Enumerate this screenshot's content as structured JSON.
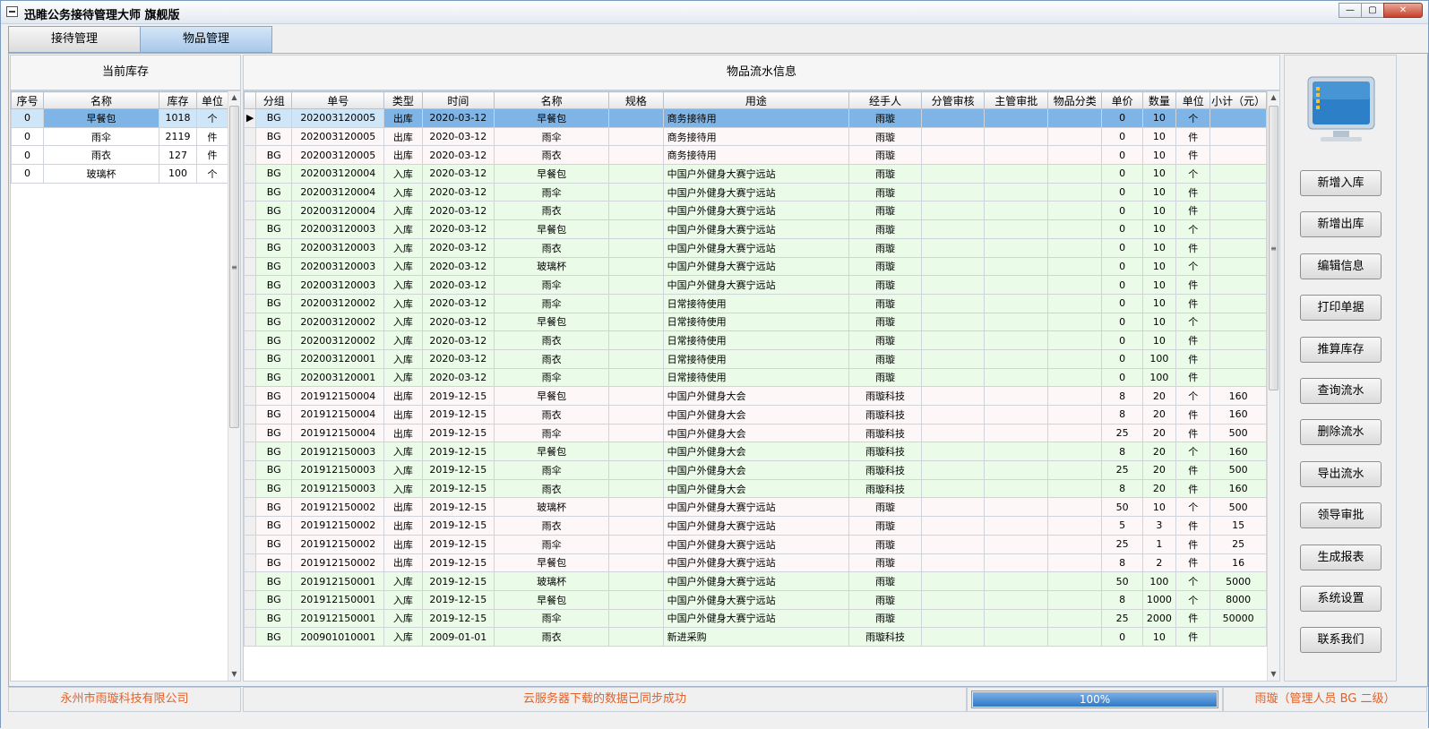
{
  "window": {
    "title": "迅睢公务接待管理大师   旗舰版"
  },
  "tabs": [
    {
      "label": "接待管理"
    },
    {
      "label": "物品管理"
    }
  ],
  "inventory": {
    "header": "当前库存",
    "columns": [
      "序号",
      "名称",
      "库存",
      "单位"
    ],
    "rows": [
      {
        "seq": "0",
        "name": "早餐包",
        "stock": "1018",
        "unit": "个"
      },
      {
        "seq": "0",
        "name": "雨伞",
        "stock": "2119",
        "unit": "件"
      },
      {
        "seq": "0",
        "name": "雨衣",
        "stock": "127",
        "unit": "件"
      },
      {
        "seq": "0",
        "name": "玻璃杯",
        "stock": "100",
        "unit": "个"
      }
    ]
  },
  "flow": {
    "header": "物品流水信息",
    "columns": [
      "分组",
      "单号",
      "类型",
      "时间",
      "名称",
      "规格",
      "用途",
      "经手人",
      "分管审核",
      "主管审批",
      "物品分类",
      "单价",
      "数量",
      "单位",
      "小计（元）"
    ],
    "rows": [
      {
        "group": "BG",
        "no": "202003120005",
        "type": "出库",
        "time": "2020-03-12",
        "name": "早餐包",
        "spec": "",
        "purpose": "商务接待用",
        "handler": "雨璇",
        "r1": "",
        "r2": "",
        "cat": "",
        "price": "0",
        "qty": "10",
        "unit": "个",
        "subtotal": ""
      },
      {
        "group": "BG",
        "no": "202003120005",
        "type": "出库",
        "time": "2020-03-12",
        "name": "雨伞",
        "spec": "",
        "purpose": "商务接待用",
        "handler": "雨璇",
        "r1": "",
        "r2": "",
        "cat": "",
        "price": "0",
        "qty": "10",
        "unit": "件",
        "subtotal": ""
      },
      {
        "group": "BG",
        "no": "202003120005",
        "type": "出库",
        "time": "2020-03-12",
        "name": "雨衣",
        "spec": "",
        "purpose": "商务接待用",
        "handler": "雨璇",
        "r1": "",
        "r2": "",
        "cat": "",
        "price": "0",
        "qty": "10",
        "unit": "件",
        "subtotal": ""
      },
      {
        "group": "BG",
        "no": "202003120004",
        "type": "入库",
        "time": "2020-03-12",
        "name": "早餐包",
        "spec": "",
        "purpose": "中国户外健身大赛宁远站",
        "handler": "雨璇",
        "r1": "",
        "r2": "",
        "cat": "",
        "price": "0",
        "qty": "10",
        "unit": "个",
        "subtotal": ""
      },
      {
        "group": "BG",
        "no": "202003120004",
        "type": "入库",
        "time": "2020-03-12",
        "name": "雨伞",
        "spec": "",
        "purpose": "中国户外健身大赛宁远站",
        "handler": "雨璇",
        "r1": "",
        "r2": "",
        "cat": "",
        "price": "0",
        "qty": "10",
        "unit": "件",
        "subtotal": ""
      },
      {
        "group": "BG",
        "no": "202003120004",
        "type": "入库",
        "time": "2020-03-12",
        "name": "雨衣",
        "spec": "",
        "purpose": "中国户外健身大赛宁远站",
        "handler": "雨璇",
        "r1": "",
        "r2": "",
        "cat": "",
        "price": "0",
        "qty": "10",
        "unit": "件",
        "subtotal": ""
      },
      {
        "group": "BG",
        "no": "202003120003",
        "type": "入库",
        "time": "2020-03-12",
        "name": "早餐包",
        "spec": "",
        "purpose": "中国户外健身大赛宁远站",
        "handler": "雨璇",
        "r1": "",
        "r2": "",
        "cat": "",
        "price": "0",
        "qty": "10",
        "unit": "个",
        "subtotal": ""
      },
      {
        "group": "BG",
        "no": "202003120003",
        "type": "入库",
        "time": "2020-03-12",
        "name": "雨衣",
        "spec": "",
        "purpose": "中国户外健身大赛宁远站",
        "handler": "雨璇",
        "r1": "",
        "r2": "",
        "cat": "",
        "price": "0",
        "qty": "10",
        "unit": "件",
        "subtotal": ""
      },
      {
        "group": "BG",
        "no": "202003120003",
        "type": "入库",
        "time": "2020-03-12",
        "name": "玻璃杯",
        "spec": "",
        "purpose": "中国户外健身大赛宁远站",
        "handler": "雨璇",
        "r1": "",
        "r2": "",
        "cat": "",
        "price": "0",
        "qty": "10",
        "unit": "个",
        "subtotal": ""
      },
      {
        "group": "BG",
        "no": "202003120003",
        "type": "入库",
        "time": "2020-03-12",
        "name": "雨伞",
        "spec": "",
        "purpose": "中国户外健身大赛宁远站",
        "handler": "雨璇",
        "r1": "",
        "r2": "",
        "cat": "",
        "price": "0",
        "qty": "10",
        "unit": "件",
        "subtotal": ""
      },
      {
        "group": "BG",
        "no": "202003120002",
        "type": "入库",
        "time": "2020-03-12",
        "name": "雨伞",
        "spec": "",
        "purpose": "日常接待使用",
        "handler": "雨璇",
        "r1": "",
        "r2": "",
        "cat": "",
        "price": "0",
        "qty": "10",
        "unit": "件",
        "subtotal": ""
      },
      {
        "group": "BG",
        "no": "202003120002",
        "type": "入库",
        "time": "2020-03-12",
        "name": "早餐包",
        "spec": "",
        "purpose": "日常接待使用",
        "handler": "雨璇",
        "r1": "",
        "r2": "",
        "cat": "",
        "price": "0",
        "qty": "10",
        "unit": "个",
        "subtotal": ""
      },
      {
        "group": "BG",
        "no": "202003120002",
        "type": "入库",
        "time": "2020-03-12",
        "name": "雨衣",
        "spec": "",
        "purpose": "日常接待使用",
        "handler": "雨璇",
        "r1": "",
        "r2": "",
        "cat": "",
        "price": "0",
        "qty": "10",
        "unit": "件",
        "subtotal": ""
      },
      {
        "group": "BG",
        "no": "202003120001",
        "type": "入库",
        "time": "2020-03-12",
        "name": "雨衣",
        "spec": "",
        "purpose": "日常接待使用",
        "handler": "雨璇",
        "r1": "",
        "r2": "",
        "cat": "",
        "price": "0",
        "qty": "100",
        "unit": "件",
        "subtotal": ""
      },
      {
        "group": "BG",
        "no": "202003120001",
        "type": "入库",
        "time": "2020-03-12",
        "name": "雨伞",
        "spec": "",
        "purpose": "日常接待使用",
        "handler": "雨璇",
        "r1": "",
        "r2": "",
        "cat": "",
        "price": "0",
        "qty": "100",
        "unit": "件",
        "subtotal": ""
      },
      {
        "group": "BG",
        "no": "201912150004",
        "type": "出库",
        "time": "2019-12-15",
        "name": "早餐包",
        "spec": "",
        "purpose": "中国户外健身大会",
        "handler": "雨璇科技",
        "r1": "",
        "r2": "",
        "cat": "",
        "price": "8",
        "qty": "20",
        "unit": "个",
        "subtotal": "160"
      },
      {
        "group": "BG",
        "no": "201912150004",
        "type": "出库",
        "time": "2019-12-15",
        "name": "雨衣",
        "spec": "",
        "purpose": "中国户外健身大会",
        "handler": "雨璇科技",
        "r1": "",
        "r2": "",
        "cat": "",
        "price": "8",
        "qty": "20",
        "unit": "件",
        "subtotal": "160"
      },
      {
        "group": "BG",
        "no": "201912150004",
        "type": "出库",
        "time": "2019-12-15",
        "name": "雨伞",
        "spec": "",
        "purpose": "中国户外健身大会",
        "handler": "雨璇科技",
        "r1": "",
        "r2": "",
        "cat": "",
        "price": "25",
        "qty": "20",
        "unit": "件",
        "subtotal": "500"
      },
      {
        "group": "BG",
        "no": "201912150003",
        "type": "入库",
        "time": "2019-12-15",
        "name": "早餐包",
        "spec": "",
        "purpose": "中国户外健身大会",
        "handler": "雨璇科技",
        "r1": "",
        "r2": "",
        "cat": "",
        "price": "8",
        "qty": "20",
        "unit": "个",
        "subtotal": "160"
      },
      {
        "group": "BG",
        "no": "201912150003",
        "type": "入库",
        "time": "2019-12-15",
        "name": "雨伞",
        "spec": "",
        "purpose": "中国户外健身大会",
        "handler": "雨璇科技",
        "r1": "",
        "r2": "",
        "cat": "",
        "price": "25",
        "qty": "20",
        "unit": "件",
        "subtotal": "500"
      },
      {
        "group": "BG",
        "no": "201912150003",
        "type": "入库",
        "time": "2019-12-15",
        "name": "雨衣",
        "spec": "",
        "purpose": "中国户外健身大会",
        "handler": "雨璇科技",
        "r1": "",
        "r2": "",
        "cat": "",
        "price": "8",
        "qty": "20",
        "unit": "件",
        "subtotal": "160"
      },
      {
        "group": "BG",
        "no": "201912150002",
        "type": "出库",
        "time": "2019-12-15",
        "name": "玻璃杯",
        "spec": "",
        "purpose": "中国户外健身大赛宁远站",
        "handler": "雨璇",
        "r1": "",
        "r2": "",
        "cat": "",
        "price": "50",
        "qty": "10",
        "unit": "个",
        "subtotal": "500"
      },
      {
        "group": "BG",
        "no": "201912150002",
        "type": "出库",
        "time": "2019-12-15",
        "name": "雨衣",
        "spec": "",
        "purpose": "中国户外健身大赛宁远站",
        "handler": "雨璇",
        "r1": "",
        "r2": "",
        "cat": "",
        "price": "5",
        "qty": "3",
        "unit": "件",
        "subtotal": "15"
      },
      {
        "group": "BG",
        "no": "201912150002",
        "type": "出库",
        "time": "2019-12-15",
        "name": "雨伞",
        "spec": "",
        "purpose": "中国户外健身大赛宁远站",
        "handler": "雨璇",
        "r1": "",
        "r2": "",
        "cat": "",
        "price": "25",
        "qty": "1",
        "unit": "件",
        "subtotal": "25"
      },
      {
        "group": "BG",
        "no": "201912150002",
        "type": "出库",
        "time": "2019-12-15",
        "name": "早餐包",
        "spec": "",
        "purpose": "中国户外健身大赛宁远站",
        "handler": "雨璇",
        "r1": "",
        "r2": "",
        "cat": "",
        "price": "8",
        "qty": "2",
        "unit": "件",
        "subtotal": "16"
      },
      {
        "group": "BG",
        "no": "201912150001",
        "type": "入库",
        "time": "2019-12-15",
        "name": "玻璃杯",
        "spec": "",
        "purpose": "中国户外健身大赛宁远站",
        "handler": "雨璇",
        "r1": "",
        "r2": "",
        "cat": "",
        "price": "50",
        "qty": "100",
        "unit": "个",
        "subtotal": "5000"
      },
      {
        "group": "BG",
        "no": "201912150001",
        "type": "入库",
        "time": "2019-12-15",
        "name": "早餐包",
        "spec": "",
        "purpose": "中国户外健身大赛宁远站",
        "handler": "雨璇",
        "r1": "",
        "r2": "",
        "cat": "",
        "price": "8",
        "qty": "1000",
        "unit": "个",
        "subtotal": "8000"
      },
      {
        "group": "BG",
        "no": "201912150001",
        "type": "入库",
        "time": "2019-12-15",
        "name": "雨伞",
        "spec": "",
        "purpose": "中国户外健身大赛宁远站",
        "handler": "雨璇",
        "r1": "",
        "r2": "",
        "cat": "",
        "price": "25",
        "qty": "2000",
        "unit": "件",
        "subtotal": "50000"
      },
      {
        "group": "BG",
        "no": "200901010001",
        "type": "入库",
        "time": "2009-01-01",
        "name": "雨衣",
        "spec": "",
        "purpose": "新进采购",
        "handler": "雨璇科技",
        "r1": "",
        "r2": "",
        "cat": "",
        "price": "0",
        "qty": "10",
        "unit": "件",
        "subtotal": ""
      }
    ]
  },
  "actions": [
    "新增入库",
    "新增出库",
    "编辑信息",
    "打印单据",
    "推算库存",
    "查询流水",
    "删除流水",
    "导出流水",
    "领导审批",
    "生成报表",
    "系统设置",
    "联系我们"
  ],
  "status": {
    "company": "永州市雨璇科技有限公司",
    "message": "云服务器下载的数据已同步成功",
    "progress_label": "100%",
    "progress_value": 1.0,
    "user": "雨璇（管理人员   BG   二级）"
  },
  "colors": {
    "status_text": "#e0622b",
    "in_row": "#eafbe8",
    "out_row": "#fdf7f7",
    "selected": "#7fb5e6",
    "progress": "#2f78c8"
  }
}
